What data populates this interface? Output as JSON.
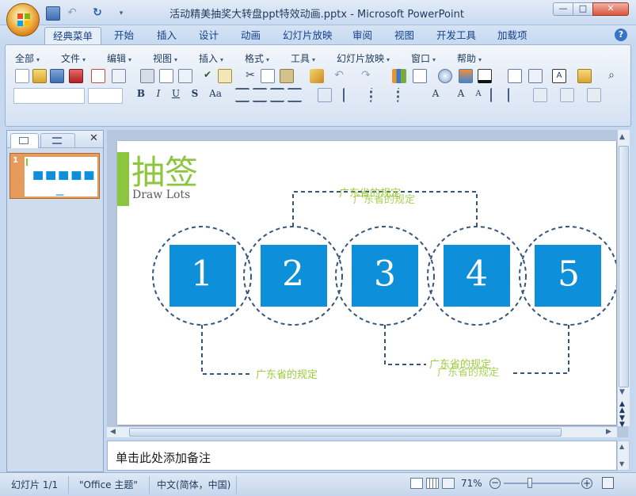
{
  "window": {
    "title": "活动精美抽奖大转盘ppt特效动画.pptx - Microsoft PowerPoint",
    "minimize": "—",
    "maximize": "□",
    "close": "✕"
  },
  "tabs": [
    "经典菜单",
    "开始",
    "插入",
    "设计",
    "动画",
    "幻灯片放映",
    "审阅",
    "视图",
    "开发工具",
    "加载项"
  ],
  "menu": [
    "全部",
    "文件",
    "编辑",
    "视图",
    "插入",
    "格式",
    "工具",
    "幻灯片放映",
    "窗口",
    "帮助"
  ],
  "panel": {
    "close": "✕",
    "slide_number": "1"
  },
  "slide": {
    "title_cn": "抽签",
    "title_en": "Draw Lots",
    "boxes": [
      "1",
      "2",
      "3",
      "4",
      "5"
    ],
    "labels": {
      "top": "广东省的规定",
      "bottom_left": "广东省的规定",
      "bottom_right": "广东省的规定"
    }
  },
  "notes": {
    "placeholder": "单击此处添加备注"
  },
  "status": {
    "slide": "幻灯片 1/1",
    "theme": "\"Office 主题\"",
    "language": "中文(简体，中国)",
    "zoom": "71%",
    "zoom_level": 0.71
  },
  "colors": {
    "accent_blue": "#0d8fd9",
    "accent_green": "#8cc63e",
    "dash": "#36567a"
  }
}
